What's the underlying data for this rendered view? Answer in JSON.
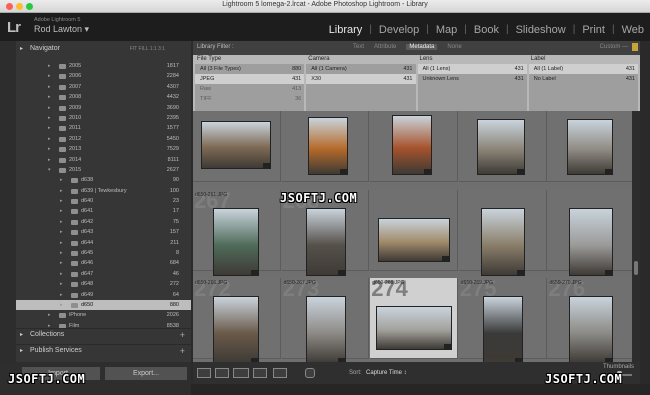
{
  "window": {
    "title": "Lightroom 5 lomega-2.lrcat - Adobe Photoshop Lightroom - Library"
  },
  "identity": {
    "logo": "Lr",
    "product": "Adobe Lightroom 5",
    "user": "Rod Lawton ▾"
  },
  "modules": [
    "Library",
    "Develop",
    "Map",
    "Book",
    "Slideshow",
    "Print",
    "Web"
  ],
  "active_module": "Library",
  "navigator": {
    "label": "Navigator",
    "options": "FIT  FILL  1:1  3:1"
  },
  "folders": [
    {
      "name": "2005",
      "count": "1817",
      "level": 1
    },
    {
      "name": "2006",
      "count": "2284",
      "level": 1
    },
    {
      "name": "2007",
      "count": "4307",
      "level": 1
    },
    {
      "name": "2008",
      "count": "4432",
      "level": 1
    },
    {
      "name": "2009",
      "count": "3690",
      "level": 1
    },
    {
      "name": "2010",
      "count": "2395",
      "level": 1
    },
    {
      "name": "2011",
      "count": "1577",
      "level": 1
    },
    {
      "name": "2012",
      "count": "5450",
      "level": 1
    },
    {
      "name": "2013",
      "count": "7529",
      "level": 1
    },
    {
      "name": "2014",
      "count": "8111",
      "level": 1
    },
    {
      "name": "2015",
      "count": "2627",
      "level": 1,
      "open": true
    },
    {
      "name": "d638",
      "count": "90",
      "level": 2
    },
    {
      "name": "d639 | Tewkesbury",
      "count": "100",
      "level": 2
    },
    {
      "name": "d640",
      "count": "23",
      "level": 2
    },
    {
      "name": "d641",
      "count": "17",
      "level": 2
    },
    {
      "name": "d642",
      "count": "75",
      "level": 2
    },
    {
      "name": "d643",
      "count": "157",
      "level": 2
    },
    {
      "name": "d644",
      "count": "211",
      "level": 2
    },
    {
      "name": "d645",
      "count": "8",
      "level": 2
    },
    {
      "name": "d646",
      "count": "684",
      "level": 2
    },
    {
      "name": "d647",
      "count": "46",
      "level": 2
    },
    {
      "name": "d648",
      "count": "272",
      "level": 2
    },
    {
      "name": "d649",
      "count": "64",
      "level": 2
    },
    {
      "name": "d650",
      "count": "880",
      "level": 2,
      "selected": true
    },
    {
      "name": "iPhone",
      "count": "2026",
      "level": 1
    },
    {
      "name": "Film",
      "count": "8538",
      "level": 0
    }
  ],
  "panels": {
    "collections": "Collections",
    "publish": "Publish Services",
    "import": "Import...",
    "export": "Export..."
  },
  "filter_bar": {
    "title": "Library Filter :",
    "tabs": [
      "Text",
      "Attribute",
      "Metadata",
      "None"
    ],
    "active_tab": "Metadata",
    "preset": "Custom —"
  },
  "filter_columns": [
    {
      "header": "File Type",
      "rows": [
        {
          "label": "All (3 File Types)",
          "count": "880",
          "selected": false
        },
        {
          "label": "JPEG",
          "count": "431",
          "selected": true
        },
        {
          "label": "Raw",
          "count": "413",
          "dim": true
        },
        {
          "label": "TIFF",
          "count": "36",
          "dim": true
        }
      ]
    },
    {
      "header": "Camera",
      "rows": [
        {
          "label": "All (1 Camera)",
          "count": "431",
          "selected": false
        },
        {
          "label": "X30",
          "count": "431",
          "selected": true
        }
      ]
    },
    {
      "header": "Lens",
      "rows": [
        {
          "label": "All (1 Lens)",
          "count": "431",
          "selected": true
        },
        {
          "label": "Unknown Lens",
          "count": "431",
          "selected": false
        }
      ]
    },
    {
      "header": "Label",
      "rows": [
        {
          "label": "All (1 Label)",
          "count": "431",
          "selected": true
        },
        {
          "label": "No Label",
          "count": "431",
          "selected": false
        }
      ]
    }
  ],
  "grid": [
    {
      "num": "",
      "file": "",
      "selected": false
    },
    {
      "num": "",
      "file": "",
      "selected": false
    },
    {
      "num": "",
      "file": "",
      "selected": false
    },
    {
      "num": "",
      "file": "",
      "selected": false
    },
    {
      "num": "",
      "file": "",
      "selected": false
    },
    {
      "num": "267",
      "file": "d650-261.JPG",
      "selected": false
    },
    {
      "num": "268",
      "file": "d650-262.JPG",
      "selected": false
    },
    {
      "num": "",
      "file": "",
      "selected": false
    },
    {
      "num": "",
      "file": "",
      "selected": false
    },
    {
      "num": "",
      "file": "",
      "selected": false
    },
    {
      "num": "272",
      "file": "d650-266.JPG",
      "selected": false
    },
    {
      "num": "273",
      "file": "d650-267.JPG",
      "selected": false
    },
    {
      "num": "274",
      "file": "d650-268.JPG",
      "selected": true
    },
    {
      "num": "275",
      "file": "d650-269.JPG",
      "selected": false
    },
    {
      "num": "276",
      "file": "d650-270.JPG",
      "selected": false
    }
  ],
  "toolbar": {
    "sort_label": "Sort:",
    "sort_value": "Capture Time ↕",
    "thumbnails": "Thumbnails"
  },
  "watermarks": [
    "JSOFTJ.COM",
    "JSOFTJ.COM",
    "JSOFTJ.COM"
  ]
}
